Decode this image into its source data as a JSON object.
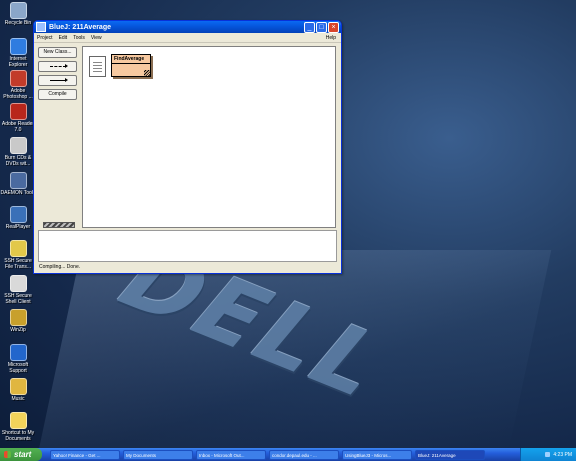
{
  "desktop": {
    "icons": [
      {
        "label": "Recycle Bin",
        "icon": "recycle-bin-icon",
        "color": "#8aa6c9"
      },
      {
        "label": "Internet Explorer",
        "icon": "internet-explorer-icon",
        "color": "#2f7ce0"
      },
      {
        "label": "Adobe Photoshop ...",
        "icon": "photoshop-icon",
        "color": "#c23b2a"
      },
      {
        "label": "Adobe Reader 7.0",
        "icon": "adobe-reader-icon",
        "color": "#b8261c"
      },
      {
        "label": "Burn CDs & DVDs wit...",
        "icon": "cd-burner-icon",
        "color": "#c9c9c9"
      },
      {
        "label": "DAEMON Tools",
        "icon": "daemon-tools-icon",
        "color": "#4a6aa0"
      },
      {
        "label": "RealPlayer",
        "icon": "realplayer-icon",
        "color": "#3a70b8"
      },
      {
        "label": "SSH Secure File Trans...",
        "icon": "ssh-file-transfer-icon",
        "color": "#e2c84a"
      },
      {
        "label": "SSH Secure Shell Client",
        "icon": "ssh-shell-icon",
        "color": "#d9d9d9"
      },
      {
        "label": "WinZip",
        "icon": "winzip-icon",
        "color": "#c8a02c"
      },
      {
        "label": "Microsoft Support",
        "icon": "help-support-icon",
        "color": "#2266cc"
      },
      {
        "label": "Music",
        "icon": "music-icon",
        "color": "#e0b640"
      },
      {
        "label": "Shortcut to My Documents",
        "icon": "folder-icon",
        "color": "#f2d35a"
      }
    ]
  },
  "window": {
    "title": "BlueJ:  211Average",
    "menu": [
      "Project",
      "Edit",
      "Tools",
      "View"
    ],
    "help": "Help",
    "buttons": {
      "new_class": "New Class...",
      "compile": "Compile"
    },
    "class_name": "FindAverage",
    "status": "Compiling... Done."
  },
  "taskbar": {
    "start": "start",
    "tasks": [
      "Yahoo! Finance - Get ...",
      "My Documents",
      "Inbox - Microsoft Out...",
      "condor.depaul.edu - ...",
      "UsingBlueJ3 - Micros...",
      "BlueJ: 211Average"
    ],
    "clock": "4:23 PM"
  }
}
